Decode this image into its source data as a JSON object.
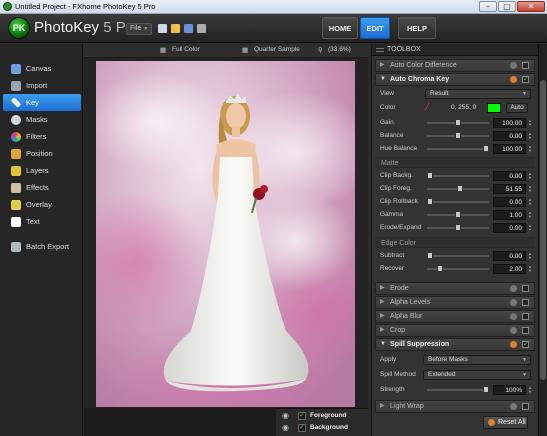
{
  "window": {
    "title": "Untitled Project - FXhome PhotoKey 5 Pro",
    "buttons": [
      "–",
      "□",
      "✕"
    ]
  },
  "header": {
    "logo_text": "PK",
    "app_name": "PhotoKey",
    "app_version": "5 Pro",
    "file_menu": "File",
    "nav": {
      "home": "HOME",
      "edit": "EDIT",
      "help": "HELP"
    }
  },
  "sidebar": {
    "items": [
      {
        "label": "Canvas",
        "icon": "canvas-icon",
        "color": "#6d9ee0"
      },
      {
        "label": "Import",
        "icon": "import-icon",
        "color": "#9aa4b0"
      },
      {
        "label": "Key",
        "icon": "key-icon",
        "color": "#f0f0f0",
        "active": true
      },
      {
        "label": "Masks",
        "icon": "masks-icon",
        "color": "#cfd6dc"
      },
      {
        "label": "Filters",
        "icon": "filters-icon",
        "color": "#e06a3a"
      },
      {
        "label": "Position",
        "icon": "position-icon",
        "color": "#e0a23a"
      },
      {
        "label": "Layers",
        "icon": "layers-icon",
        "color": "#e0c23a"
      },
      {
        "label": "Effects",
        "icon": "effects-icon",
        "color": "#d0c0a0"
      },
      {
        "label": "Overlay",
        "icon": "overlay-icon",
        "color": "#e0d04a"
      },
      {
        "label": "Text",
        "icon": "text-icon",
        "color": "#ffffff"
      },
      {
        "label": "Batch Export",
        "icon": "batch-export-icon",
        "color": "#b0b8c0"
      }
    ]
  },
  "options_bar": {
    "color_mode": "Full Color",
    "sample": "Quarter Sample",
    "zoom": "(33.6%)"
  },
  "layers": {
    "foreground": "Foreground",
    "background": "Background"
  },
  "toolbox": {
    "title": "TOOLBOX",
    "sections": {
      "auto_color_difference": "Auto Color Difference",
      "auto_chroma_key": "Auto Chroma Key",
      "erode": "Erode",
      "alpha_levels": "Alpha Levels",
      "alpha_blur": "Alpha Blur",
      "crop": "Crop",
      "spill_suppression": "Spill Suppression",
      "light_wrap": "Light Wrap"
    },
    "chroma": {
      "view_label": "View",
      "view_value": "Result",
      "color_label": "Color",
      "color_value": "0, 255, 0",
      "color_hex": "#00ff00",
      "auto_label": "Auto",
      "gain_label": "Gain",
      "gain_value": "100.00",
      "balance_label": "Balance",
      "balance_value": "0.00",
      "hue_balance_label": "Hue Balance",
      "hue_balance_value": "100.00",
      "matte_header": "Matte",
      "clip_backg_label": "Clip Backg.",
      "clip_backg_value": "0.00",
      "clip_foreg_label": "Clip Foreg.",
      "clip_foreg_value": "51.55",
      "clip_rollback_label": "Clip Rollback",
      "clip_rollback_value": "0.00",
      "gamma_label": "Gamma",
      "gamma_value": "1.00",
      "erode_expand_label": "Erode/Expand",
      "erode_expand_value": "0.00",
      "edge_color_header": "Edge Color",
      "subtract_label": "Subtract",
      "subtract_value": "0.00",
      "recover_label": "Recover",
      "recover_value": "2.00"
    },
    "spill": {
      "apply_label": "Apply",
      "apply_value": "Before Masks",
      "method_label": "Spill Method",
      "method_value": "Extended",
      "strength_label": "Strength",
      "strength_value": "100%"
    },
    "reset_all": "Reset All"
  }
}
